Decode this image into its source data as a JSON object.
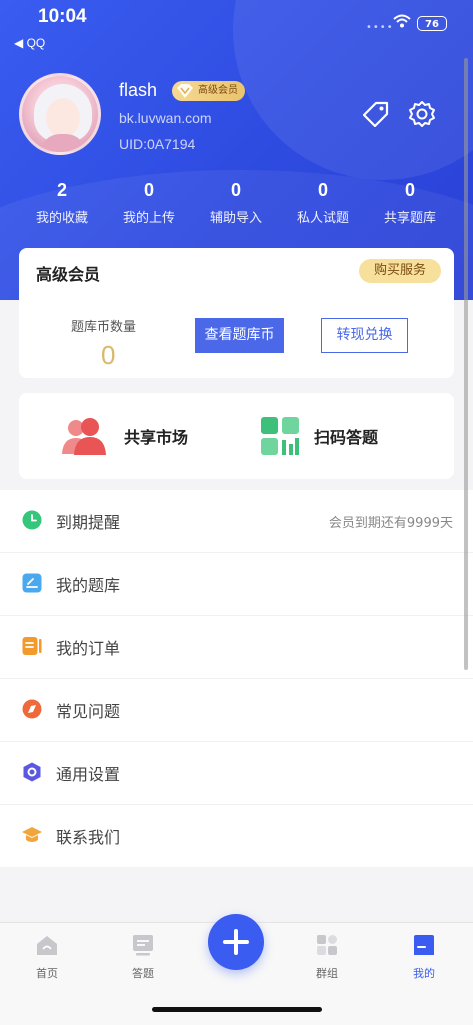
{
  "status_bar": {
    "time": "10:04",
    "back_app": "◀ QQ",
    "battery": "76"
  },
  "profile": {
    "username": "flash",
    "vip_badge": "高级会员",
    "domain": "bk.luvwan.com",
    "uid": "UID:0A7194"
  },
  "stats": [
    {
      "value": "2",
      "label": "我的收藏"
    },
    {
      "value": "0",
      "label": "我的上传"
    },
    {
      "value": "0",
      "label": "辅助导入"
    },
    {
      "value": "0",
      "label": "私人试题"
    },
    {
      "value": "0",
      "label": "共享题库"
    }
  ],
  "vip_card": {
    "title": "高级会员",
    "buy_label": "购买服务",
    "coin_label": "题库币数量",
    "coin_value": "0",
    "view_label": "查看题库币",
    "cash_label": "转现兑换"
  },
  "quick": [
    {
      "label": "共享市场",
      "icon": "people-icon"
    },
    {
      "label": "扫码答题",
      "icon": "scan-icon"
    }
  ],
  "menu": [
    {
      "label": "到期提醒",
      "icon": "clock-icon",
      "right": "会员到期还有9999天"
    },
    {
      "label": "我的题库",
      "icon": "library-icon",
      "right": ""
    },
    {
      "label": "我的订单",
      "icon": "order-icon",
      "right": ""
    },
    {
      "label": "常见问题",
      "icon": "question-icon",
      "right": ""
    },
    {
      "label": "通用设置",
      "icon": "settings-icon",
      "right": ""
    },
    {
      "label": "联系我们",
      "icon": "graduation-icon",
      "right": ""
    }
  ],
  "tabs": [
    {
      "label": "首页",
      "icon": "home-icon"
    },
    {
      "label": "答题",
      "icon": "answer-icon"
    },
    {
      "label": "群组",
      "icon": "group-icon"
    },
    {
      "label": "我的",
      "icon": "profile-icon",
      "active": true
    }
  ],
  "colors": {
    "primary": "#3a5cf0",
    "gold": "#f7e09c"
  }
}
